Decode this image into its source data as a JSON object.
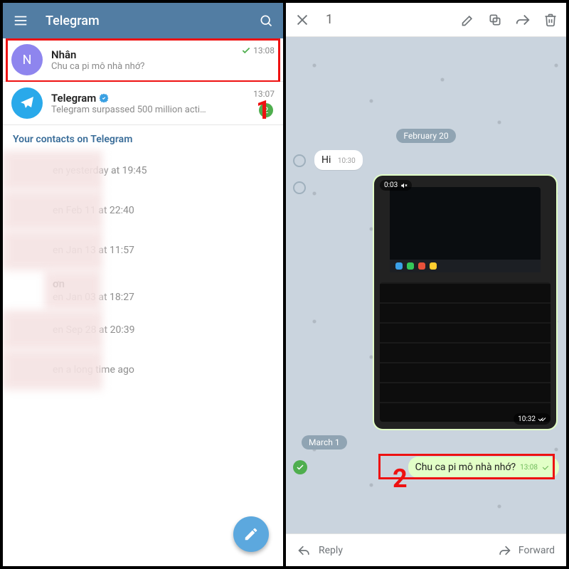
{
  "left": {
    "header": {
      "title": "Telegram"
    },
    "chats": [
      {
        "avatar_letter": "N",
        "name": "Nhân",
        "preview": "Chu ca pi mô nhà nhớ?",
        "time": "13:08",
        "check": true
      },
      {
        "name": "Telegram",
        "preview": "Telegram surpassed 500 million acti…",
        "time": "13:07",
        "badge": "2",
        "verified": true
      }
    ],
    "contacts_title": "Your contacts on Telegram",
    "contacts": [
      {
        "seen_prefix": "en ",
        "seen": "yesterday at 19:45"
      },
      {
        "seen_prefix": "en ",
        "seen": "Feb 11 at 22:40"
      },
      {
        "seen_prefix": "en ",
        "seen": "Jan 13 at 11:57"
      },
      {
        "name_fragment": "ơn",
        "seen_prefix": "en ",
        "seen": "Jan 03 at 18:27"
      },
      {
        "seen_prefix": "en ",
        "seen": "Sep 28 at 20:39"
      },
      {
        "seen_prefix": "en ",
        "seen": "a long time ago"
      }
    ],
    "step1": "1"
  },
  "right": {
    "selection_count": "1",
    "dates": {
      "d1": "February 20",
      "d2": "March 1"
    },
    "msg_in": {
      "text": "Hi",
      "time": "10:30"
    },
    "video": {
      "duration": "0:03",
      "time": "10:32"
    },
    "msg_out": {
      "text": "Chu ca pi mô nhà nhớ?",
      "time": "13:08"
    },
    "step2": "2",
    "bottom": {
      "reply": "Reply",
      "forward": "Forward"
    }
  }
}
